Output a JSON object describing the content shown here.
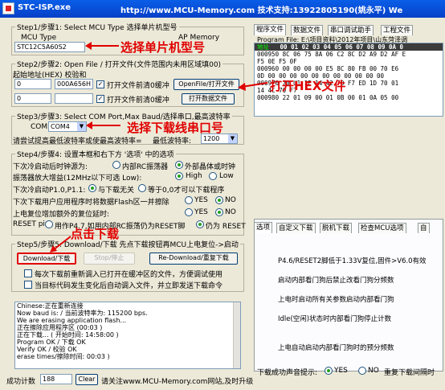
{
  "window": {
    "title": "STC-ISP.exe",
    "url_info": "http://www.MCU-Memory.com 技术支持:13922805190(姚永平) We"
  },
  "step1": {
    "legend": "Step1/步骤1: Select MCU Type  选择单片机型号",
    "mcu_type_label": "MCU Type",
    "ap_memory_label": "AP Memory",
    "mcu_value": "STC12C5A60S2"
  },
  "step2": {
    "legend": "Step2/步骤2: Open File / 打开文件(文件范围内未用区域填00)",
    "addr_label": "起始地址(HEX)  校验和",
    "addr1": "0",
    "checksum1": "000A656H",
    "clear1_label": "打开文件前清0缓冲",
    "open_file_button": "OpenFile/打开文件",
    "addr2": "0",
    "clear2_label": "打开文件前清0缓冲",
    "open_eeprom_button": "打开数据文件"
  },
  "step3": {
    "legend": "Step3/步骤3: Select COM Port,Max Baud/选择串口,最高波特率",
    "com_label": "COM:",
    "com_value": "COM4",
    "try_label": "请尝试提高最低波特率或使最高波特率=",
    "min_baud_label": "最低波特率:",
    "min_baud_value": "1200"
  },
  "step4": {
    "legend": "Step4/步骤4: 设置本框和右下方 '选项' 中的选项",
    "clock_label": "下次冷启动后时钟源为:",
    "clock_internal": "内部RC振荡器",
    "clock_external": "外部晶体或时钟",
    "gain_label": "振荡器放大增益(12MHz以下可选 Low):",
    "gain_high": "High",
    "gain_low": "Low",
    "p10_label": "下次冷启动P1.0,P1.1:",
    "p10_opt1": "与下载无关",
    "p10_opt2": "等于0,0才可以下载程序",
    "eeprom_label": "下次下载用户应用程序时将数据Flash区一并擦除",
    "yes": "YES",
    "no": "NO",
    "reset_delay_label": "上电复位增加额外的复位延时:",
    "reset_pin_label": "RESET pin",
    "reset_pin_opt1": "用作P4.7,如用内部RC振荡仍为RESET脚",
    "reset_pin_opt2": "仍为 RESET"
  },
  "step5": {
    "legend": "Step5/步骤5: Download/下载  先点下载按钮再MCU上电复位->启动",
    "download_button": "Download/下载",
    "stop_button": "Stop/停止",
    "redownload_button": "Re-Download/重复下载",
    "option1": "每次下载前重新调入已打开在缓冲区的文件，方便调试使用",
    "option2": "当目标代码发生变化后自动调入文件，并立即发送下载命令"
  },
  "log": [
    "Chinese:正在重新连接",
    "Now baud is: / 当前波特率为: 115200 bps.",
    "We are erasing application flash...",
    "正在擦除应用程序区   (00:03 )",
    "正在下载... ( 开始时间: 14:58:00 )",
    "Program OK / 下载 OK",
    "Verify  OK / 校验 OK",
    "erase times/擦除时间: 00:03 )"
  ],
  "status": {
    "count_label": "成功计数",
    "count_value": "188",
    "clear_button": "Clear",
    "footer": "请关注www.MCU-Memory.com网站,及时升级"
  },
  "right_tabs": [
    "程序文件",
    "数据文件",
    "串口调试助手",
    "工程文件"
  ],
  "program_file_path": "Program File: E:\\项目资料\\2012年项目\\山东菏泽调",
  "hex": {
    "header_addr": "地址",
    "header_cols": "00 01 02 03 04 05 06 07 08 09 0A 0",
    "rows": [
      "000950   8C 06 75 8A 06 C2 8C D2 A9 D2 AF E",
      "F5 0E F5 0F",
      "000960   00 00 00 00 E5 8C 80 FB 00 70 E6",
      "0D 00 00 00 00 00 00 00 00 00 00 00",
      "000970   70 U1 1E 14 42 70 F7 ED 1D 70 01",
      "14 4C 70 F7",
      "000980   22 01 09 00 01 0B 00 01 0A 05 00"
    ]
  },
  "option_tabs": [
    "选项",
    "自定义下载",
    "脱机下载",
    "检查MCU选项",
    "自"
  ],
  "options": [
    "P4.6/RESET2脚低于1.33V复位,固件>V6.0有效",
    "启动内部看门狗后禁止改看门狗分频数",
    "上电时启动所有关参数启动内部看门狗",
    "Idle(空闲)状态时内部看门狗停止计数",
    "上电自动启动内部看门狗时的预分频数"
  ],
  "sound": {
    "label": "下载成功声音提示:",
    "yes": "YES",
    "no": "NO",
    "tail": "重复下载间隔时"
  },
  "annotations": {
    "a1": "选择单片机型号",
    "a2": "打开HEX文件",
    "a3": "选择下载线串口号",
    "a4": "点击下载"
  },
  "colors": {
    "annotation_red": "#e00000",
    "titlebar": "#0a5ee8"
  }
}
